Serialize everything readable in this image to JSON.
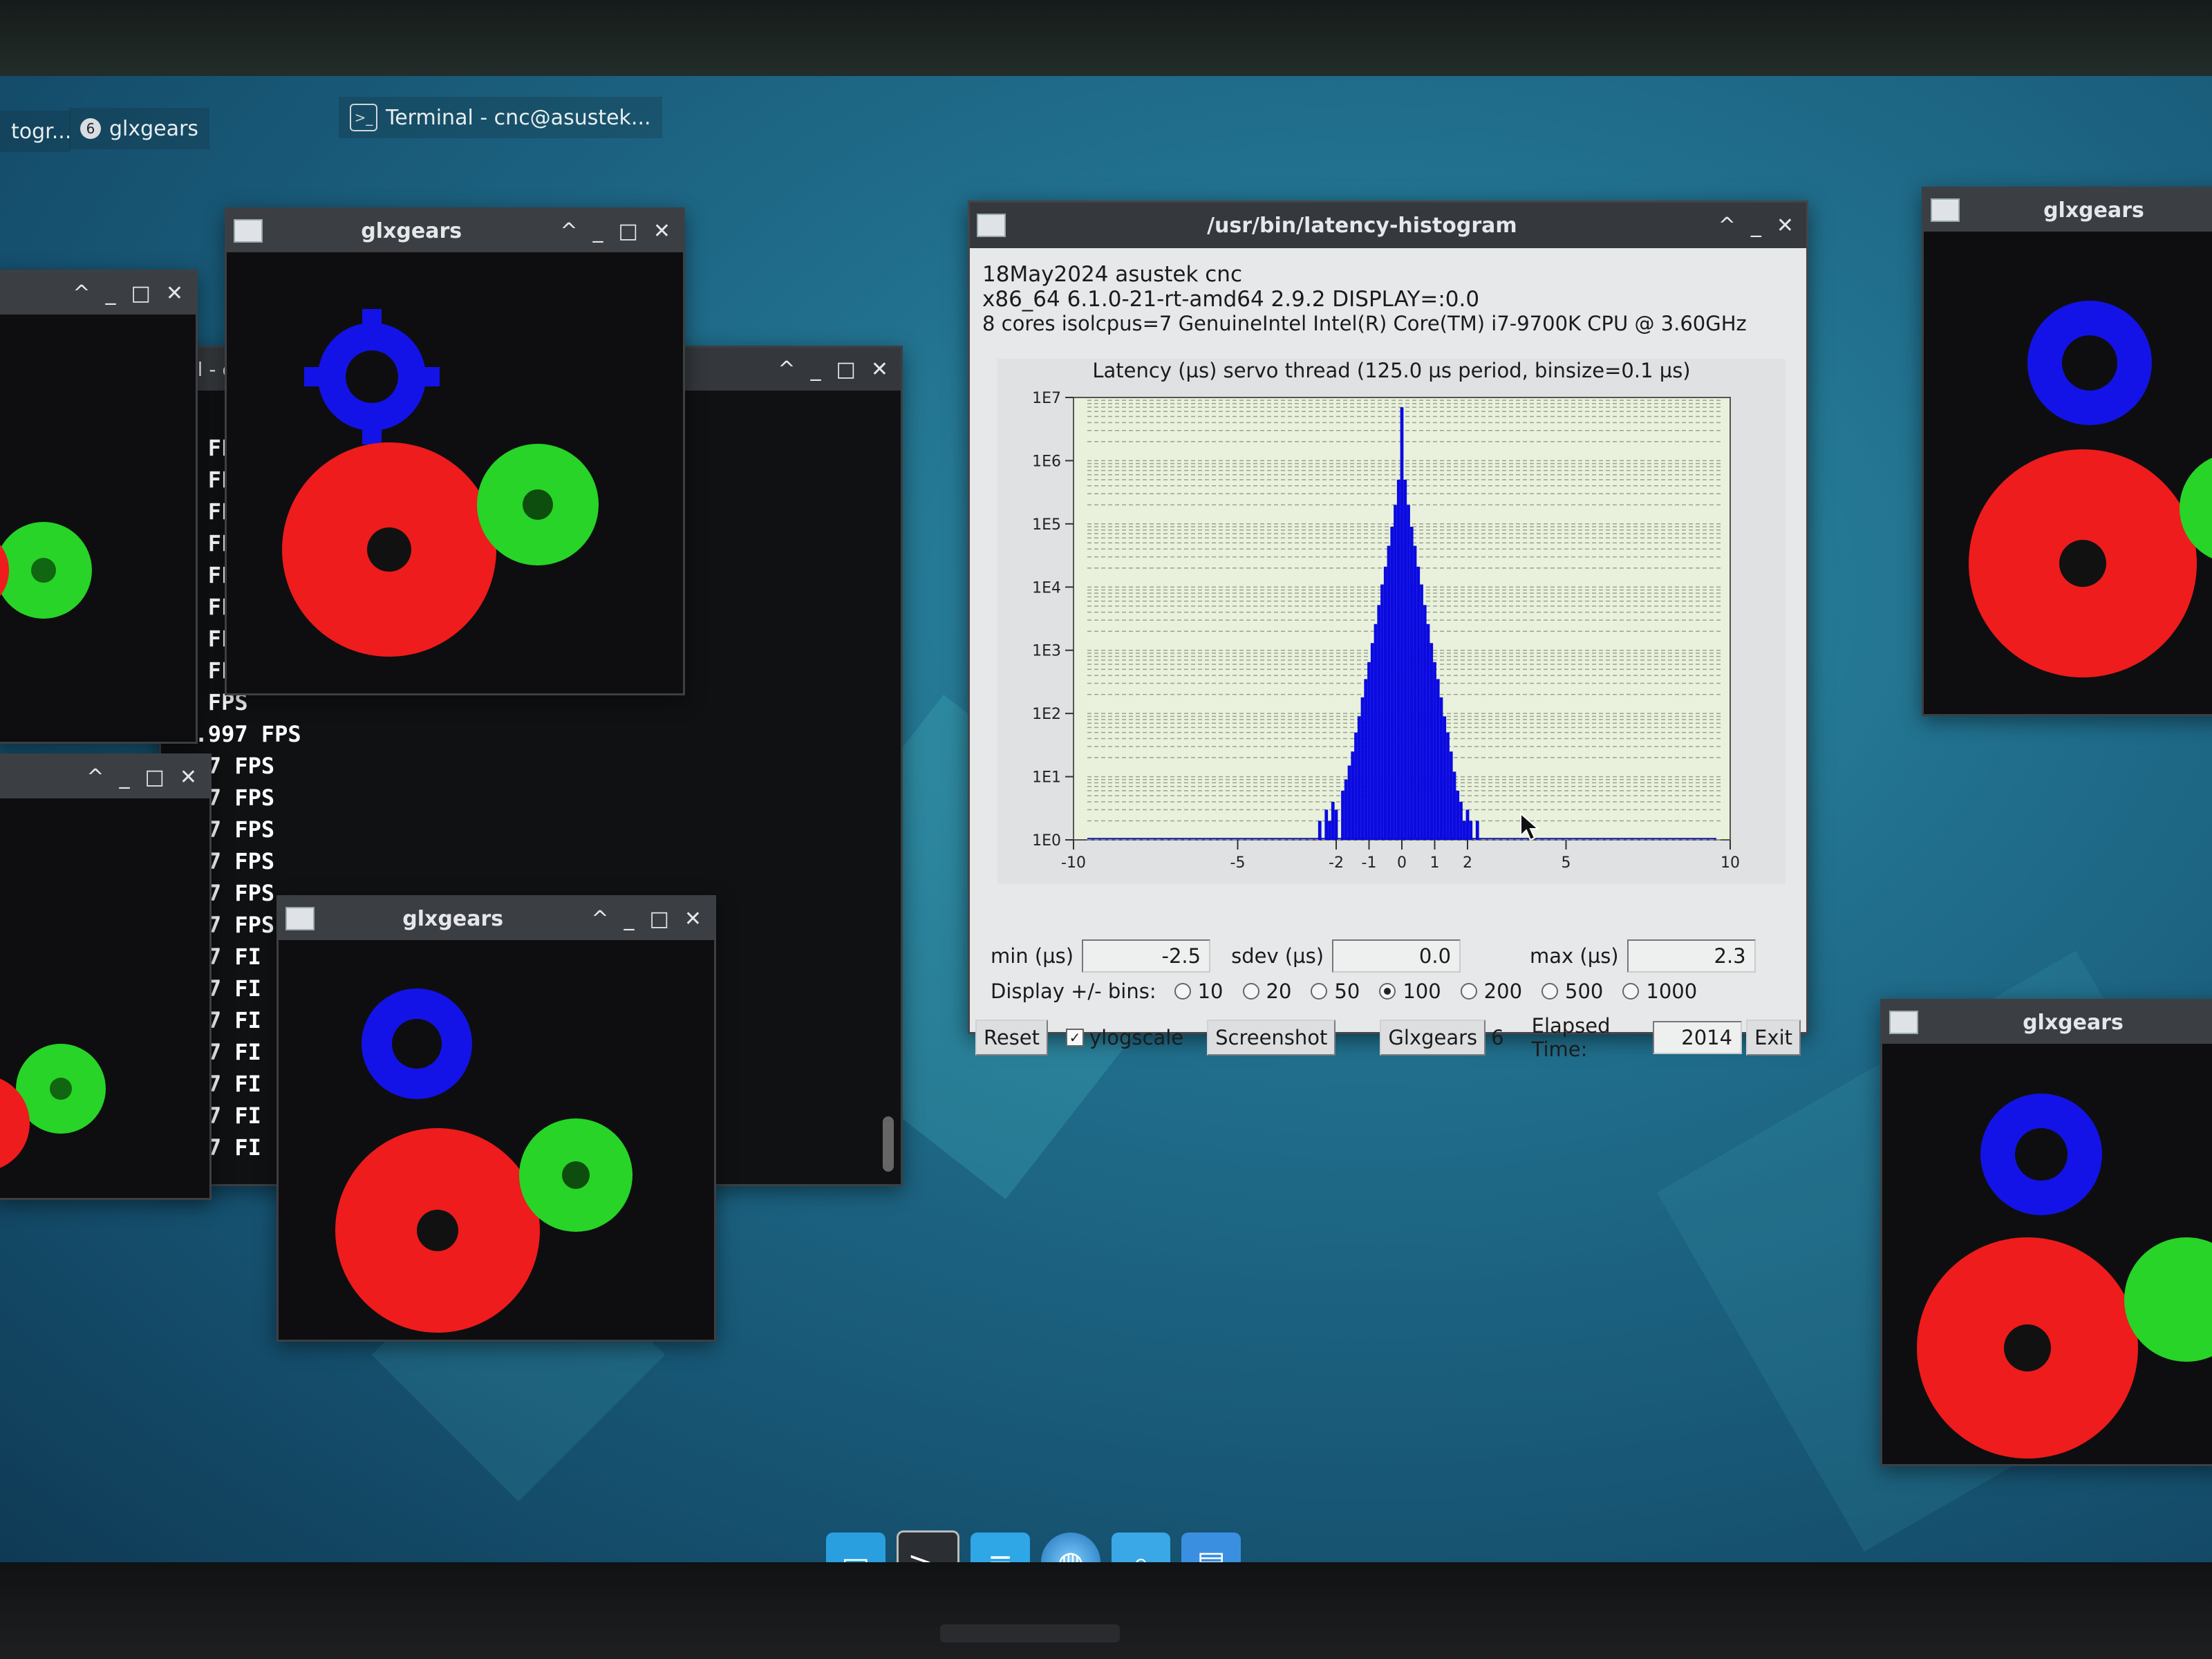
{
  "taskbar": {
    "items": [
      {
        "label": "togr...",
        "icon": "window-icon"
      },
      {
        "label": "glxgears",
        "icon": "window-icon",
        "badge": "6"
      },
      {
        "label": "Terminal - cnc@asustek...",
        "icon": "terminal-icon"
      }
    ]
  },
  "windows": {
    "glx_a": {
      "title": "glxgears"
    },
    "glx_b": {
      "title": "glxgears"
    },
    "glx_c": {
      "title": "glxgears"
    },
    "glx_d": {
      "title": "glxgears"
    },
    "terminal_partial_title": "inal - c",
    "terminal_fps_lines": [
      "97 FF",
      "97 FF",
      "97 FF",
      "97 FF",
      "97 FF",
      "97 FF",
      "97 FF",
      "97 FF",
      "97 FPS",
      "59.997 FPS",
      ".997 FPS",
      ".997 FPS",
      ".997 FPS",
      ".997 FPS",
      ".997 FPS",
      ".997 FPS",
      ".997 FI",
      ".997 FI",
      ".997 FI",
      ".997 FI",
      ".997 FI",
      ".997 FI",
      ".997 FI"
    ]
  },
  "latency": {
    "title": "/usr/bin/latency-histogram",
    "info_line1": "18May2024 asustek cnc",
    "info_line2": "x86_64  6.1.0-21-rt-amd64  2.9.2  DISPLAY=:0.0",
    "info_line3": "8 cores  isolcpus=7  GenuineIntel  Intel(R) Core(TM) i7-9700K CPU @ 3.60GHz",
    "stats": {
      "min_label": "min (µs)",
      "min_value": "-2.5",
      "sdev_label": "sdev (µs)",
      "sdev_value": "0.0",
      "max_label": "max (µs)",
      "max_value": "2.3"
    },
    "bins": {
      "label": "Display +/- bins:",
      "options": [
        "10",
        "20",
        "50",
        "100",
        "200",
        "500",
        "1000"
      ],
      "selected": "100"
    },
    "buttons": {
      "reset": "Reset",
      "ylogscale": "ylogscale",
      "ylogscale_checked": true,
      "screenshot": "Screenshot",
      "glxgears": "Glxgears",
      "glxgears_count": "6",
      "elapsed_label": "Elapsed Time:",
      "elapsed_value": "2014",
      "exit": "Exit"
    }
  },
  "chart_data": {
    "type": "bar",
    "title": "Latency (µs) servo thread (125.0 µs period, binsize=0.1 µs)",
    "xlabel": "",
    "ylabel": "",
    "xlim": [
      -10,
      10
    ],
    "ylim_log10": [
      0,
      7
    ],
    "log_y": true,
    "grid": true,
    "x_ticks": [
      "-10",
      "-5",
      "-2",
      "-1",
      "0",
      "1",
      "2",
      "5",
      "10"
    ],
    "x_tick_values": [
      -10,
      -5,
      -2,
      -1,
      0,
      1,
      2,
      5,
      10
    ],
    "y_ticks": [
      "1E0",
      "1E1",
      "1E2",
      "1E3",
      "1E4",
      "1E5",
      "1E6",
      "1E7"
    ],
    "bar_color": "#0a0ae0",
    "bins_x": [
      -2.5,
      -2.4,
      -2.3,
      -2.2,
      -2.1,
      -2.0,
      -1.9,
      -1.8,
      -1.7,
      -1.6,
      -1.5,
      -1.4,
      -1.3,
      -1.2,
      -1.1,
      -1.0,
      -0.9,
      -0.8,
      -0.7,
      -0.6,
      -0.5,
      -0.4,
      -0.3,
      -0.2,
      -0.1,
      0.0,
      0.1,
      0.2,
      0.3,
      0.4,
      0.5,
      0.6,
      0.7,
      0.8,
      0.9,
      1.0,
      1.1,
      1.2,
      1.3,
      1.4,
      1.5,
      1.6,
      1.7,
      1.8,
      1.9,
      2.0,
      2.1,
      2.2,
      2.3
    ],
    "bins_count": [
      2,
      1,
      3,
      2,
      4,
      3,
      1,
      6,
      9,
      15,
      25,
      50,
      90,
      180,
      350,
      650,
      1300,
      2600,
      5200,
      11000,
      21000,
      45000,
      90000,
      200000,
      500000,
      7000000,
      500000,
      200000,
      90000,
      45000,
      21000,
      11000,
      5200,
      2600,
      1300,
      650,
      350,
      180,
      90,
      50,
      25,
      12,
      6,
      4,
      2,
      3,
      2,
      1,
      2
    ]
  },
  "dock": {
    "items": [
      "desktop-icon",
      "terminal-icon",
      "file-icon",
      "browser-globe-icon",
      "search-icon",
      "folder-icon"
    ]
  }
}
